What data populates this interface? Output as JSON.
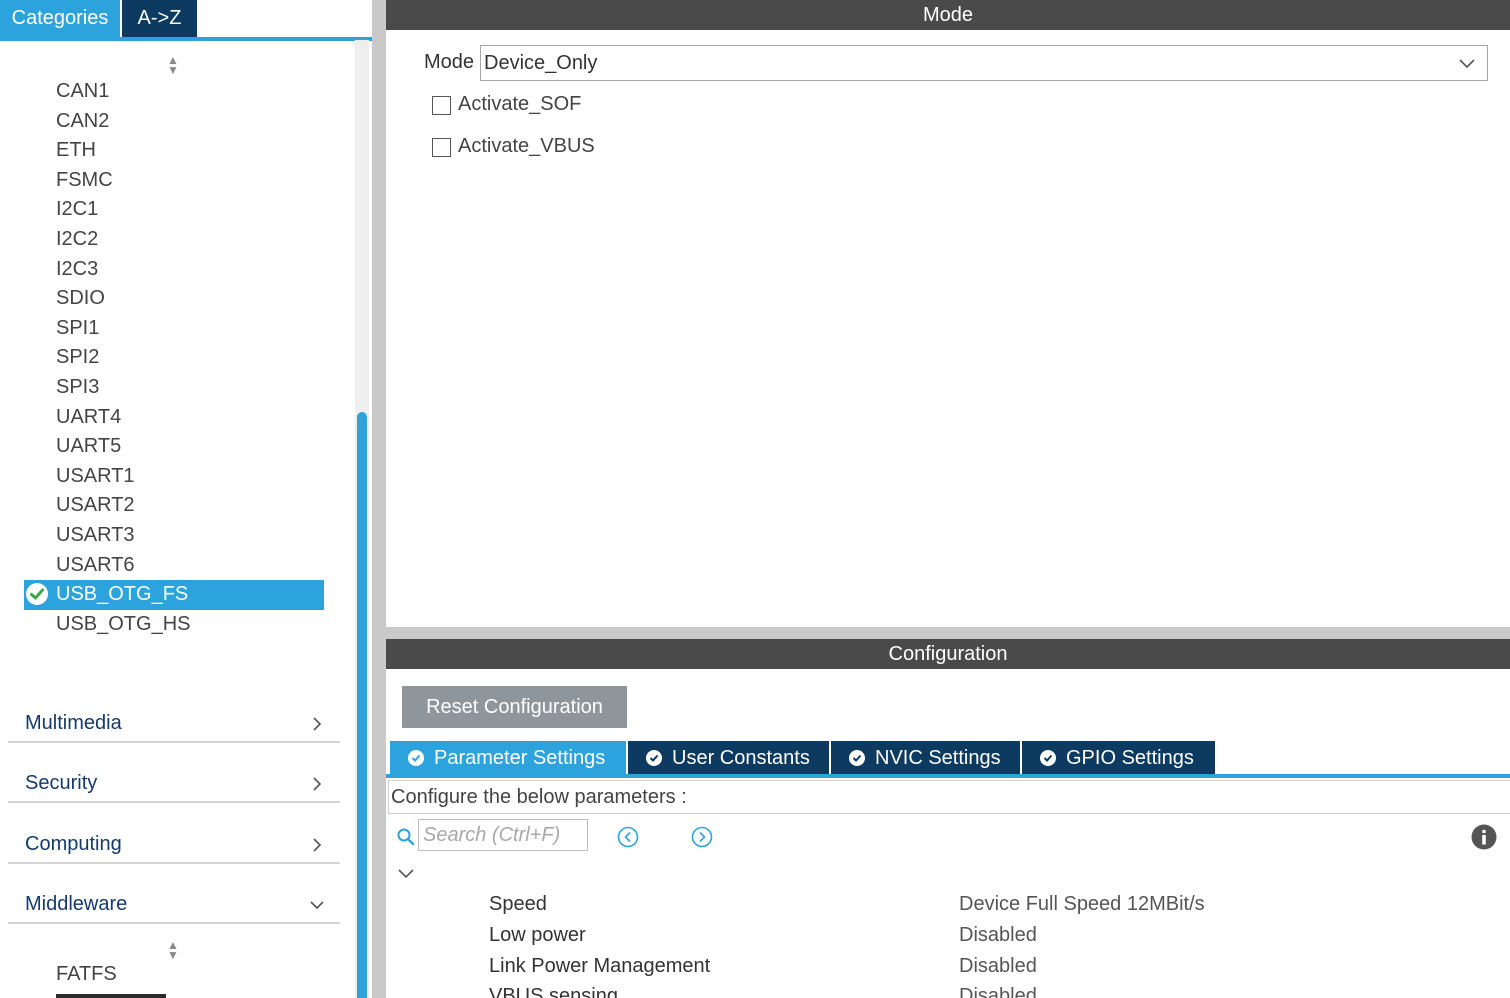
{
  "left_panel": {
    "tabs": {
      "categories": "Categories",
      "az": "A->Z"
    },
    "peripherals": [
      "CAN1",
      "CAN2",
      "ETH",
      "FSMC",
      "I2C1",
      "I2C2",
      "I2C3",
      "SDIO",
      "SPI1",
      "SPI2",
      "SPI3",
      "UART4",
      "UART5",
      "USART1",
      "USART2",
      "USART3",
      "USART6",
      "USB_OTG_FS",
      "USB_OTG_HS"
    ],
    "selected": "USB_OTG_FS",
    "categories": {
      "multimedia": "Multimedia",
      "security": "Security",
      "computing": "Computing",
      "middleware": "Middleware"
    },
    "middleware_items": [
      "FATFS"
    ]
  },
  "mode": {
    "header": "Mode",
    "mode_label": "Mode",
    "mode_value": "Device_Only",
    "activate_sof": {
      "label": "Activate_SOF",
      "checked": false
    },
    "activate_vbus": {
      "label": "Activate_VBUS",
      "checked": false
    }
  },
  "configuration": {
    "header": "Configuration",
    "reset_button": "Reset Configuration",
    "tabs": {
      "parameter_settings": "Parameter Settings",
      "user_constants": "User Constants",
      "nvic_settings": "NVIC Settings",
      "gpio_settings": "GPIO Settings"
    },
    "active_tab": "Parameter Settings",
    "description": "Configure the below parameters :",
    "search_placeholder": "Search (Ctrl+F)",
    "parameters": [
      {
        "name": "Speed",
        "value": "Device Full Speed 12MBit/s"
      },
      {
        "name": "Low power",
        "value": "Disabled"
      },
      {
        "name": "Link Power Management",
        "value": "Disabled"
      },
      {
        "name": "VBUS sensing",
        "value": "Disabled"
      }
    ]
  },
  "colors": {
    "accent": "#2ca3dd",
    "navy": "#0d3a60",
    "header_gray": "#4a4a4a",
    "button_gray": "#8e959b"
  }
}
